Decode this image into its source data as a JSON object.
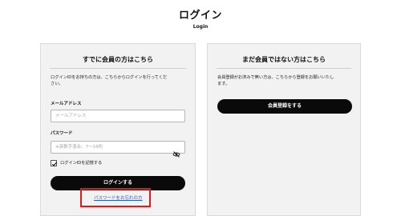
{
  "header": {
    "title": "ログイン",
    "subtitle": "Login"
  },
  "member_panel": {
    "heading": "すでに会員の方はこちら",
    "description": "ログインIDをお持ちの方は、こちらからログインを行ってくだ\nさい。",
    "email_label": "メールアドレス",
    "email_placeholder": "メールアドレス",
    "password_label": "パスワード",
    "password_placeholder": "※英数字混合、7～16桁",
    "remember_label": "ログインIDを記憶する",
    "remember_checked": true,
    "login_button": "ログインする",
    "forgot_link": "パスワードをお忘れの方",
    "password_toggle_icon": "eye-slash-icon"
  },
  "guest_panel": {
    "heading": "まだ会員ではない方はこちら",
    "description": "会員登録がお済みで無い方は、こちらから登録をお願いいたし\nます。",
    "register_button": "会員登録をする"
  },
  "colors": {
    "button_bg": "#0a0a0a",
    "panel_bg": "#f2f2f2",
    "link": "#2a5db0",
    "highlight": "#e11919"
  }
}
